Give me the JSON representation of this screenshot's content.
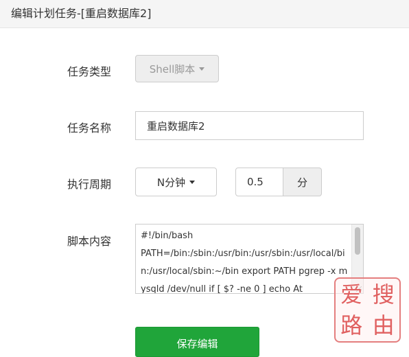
{
  "dialog": {
    "title": "编辑计划任务-[重启数据库2]"
  },
  "form": {
    "task_type": {
      "label": "任务类型",
      "value": "Shell脚本"
    },
    "task_name": {
      "label": "任务名称",
      "value": "重启数据库2"
    },
    "period": {
      "label": "执行周期",
      "unit_select": "N分钟",
      "interval_value": "0.5",
      "unit_addon": "分"
    },
    "script": {
      "label": "脚本内容",
      "content": "#!/bin/bash\nPATH=/bin:/sbin:/usr/bin:/usr/sbin:/usr/local/bin:/usr/local/sbin:~/bin export PATH pgrep -x mysqld /dev/null if [ $? -ne 0 ] echo At"
    }
  },
  "actions": {
    "save_label": "保存编辑"
  },
  "watermark": {
    "chars": [
      "爱",
      "搜",
      "路",
      "由"
    ]
  },
  "colors": {
    "primary": "#20a53a",
    "stamp": "#e06060"
  }
}
